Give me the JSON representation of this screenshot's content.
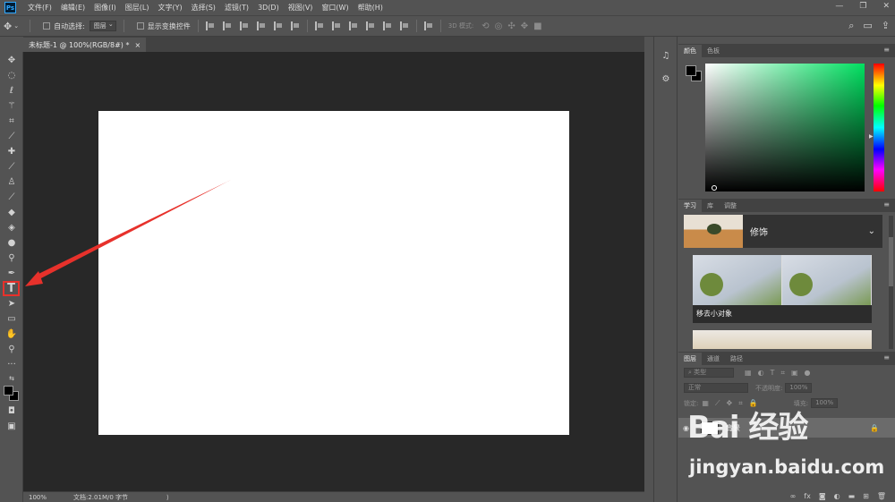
{
  "app": {
    "logo": "Ps"
  },
  "menu": [
    "文件(F)",
    "编辑(E)",
    "图像(I)",
    "图层(L)",
    "文字(Y)",
    "选择(S)",
    "滤镜(T)",
    "3D(D)",
    "视图(V)",
    "窗口(W)",
    "帮助(H)"
  ],
  "window_controls": {
    "minimize": "—",
    "restore": "❐",
    "close": "✕"
  },
  "options_bar": {
    "auto_select_label": "自动选择:",
    "auto_select_value": "图层",
    "show_transform_label": "显示变换控件",
    "mode_3d_label": "3D 模式:"
  },
  "document": {
    "tab_title": "未标题-1 @ 100%(RGB/8#) *",
    "tab_close": "×"
  },
  "status": {
    "zoom": "100%",
    "doc_info": "文档:2.01M/0 字节",
    "arrow": "⟩"
  },
  "toolbar": {
    "collapse": "««",
    "tools": [
      "move",
      "marquee",
      "lasso",
      "magic-wand",
      "crop",
      "eyedropper",
      "healing",
      "brush",
      "stamp",
      "history-brush",
      "eraser",
      "paint-bucket",
      "blur",
      "dodge",
      "pen",
      "type",
      "path-select",
      "rectangle",
      "hand",
      "zoom",
      "more"
    ],
    "type_tool_glyph": "T"
  },
  "color_panel": {
    "tabs": [
      "颜色",
      "色板"
    ],
    "foreground": "#000000",
    "background": "#000000"
  },
  "learn_panel": {
    "tabs": [
      "学习",
      "库",
      "调整"
    ],
    "section_title": "修饰",
    "card_caption": "移去小对象"
  },
  "layers_panel": {
    "tabs": [
      "图层",
      "通道",
      "路径"
    ],
    "filter_label": "类型",
    "blend_mode": "正常",
    "opacity_label": "不透明度:",
    "opacity_value": "100%",
    "lock_label": "锁定:",
    "fill_label": "填充:",
    "fill_value": "100%",
    "layer_name": "背景",
    "bottom_icons": [
      "link",
      "fx",
      "mask",
      "adjustment",
      "group",
      "new-layer",
      "trash"
    ]
  },
  "colors": {
    "highlight": "#e7312b",
    "arrow": "#e7312b"
  },
  "watermark": {
    "logo": "Bai 经验",
    "url": "jingyan.baidu.com"
  }
}
